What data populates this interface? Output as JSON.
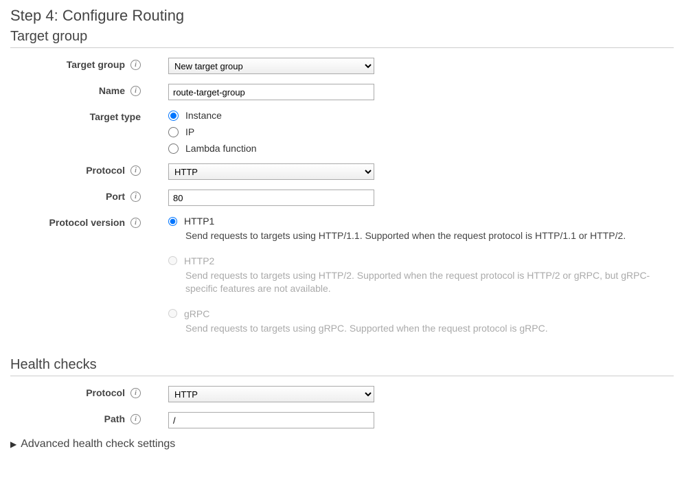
{
  "step_title": "Step 4: Configure Routing",
  "sections": {
    "target_group": {
      "title": "Target group",
      "fields": {
        "target_group": {
          "label": "Target group",
          "value": "New target group"
        },
        "name": {
          "label": "Name",
          "value": "route-target-group"
        },
        "target_type": {
          "label": "Target type",
          "options": {
            "instance": "Instance",
            "ip": "IP",
            "lambda": "Lambda function"
          },
          "selected": "instance"
        },
        "protocol": {
          "label": "Protocol",
          "value": "HTTP"
        },
        "port": {
          "label": "Port",
          "value": "80"
        },
        "protocol_version": {
          "label": "Protocol version",
          "options": {
            "http1": {
              "label": "HTTP1",
              "desc": "Send requests to targets using HTTP/1.1. Supported when the request protocol is HTTP/1.1 or HTTP/2."
            },
            "http2": {
              "label": "HTTP2",
              "desc": "Send requests to targets using HTTP/2. Supported when the request protocol is HTTP/2 or gRPC, but gRPC-specific features are not available."
            },
            "grpc": {
              "label": "gRPC",
              "desc": "Send requests to targets using gRPC. Supported when the request protocol is gRPC."
            }
          },
          "selected": "http1"
        }
      }
    },
    "health_checks": {
      "title": "Health checks",
      "fields": {
        "protocol": {
          "label": "Protocol",
          "value": "HTTP"
        },
        "path": {
          "label": "Path",
          "value": "/"
        }
      },
      "advanced_label": "Advanced health check settings"
    }
  }
}
